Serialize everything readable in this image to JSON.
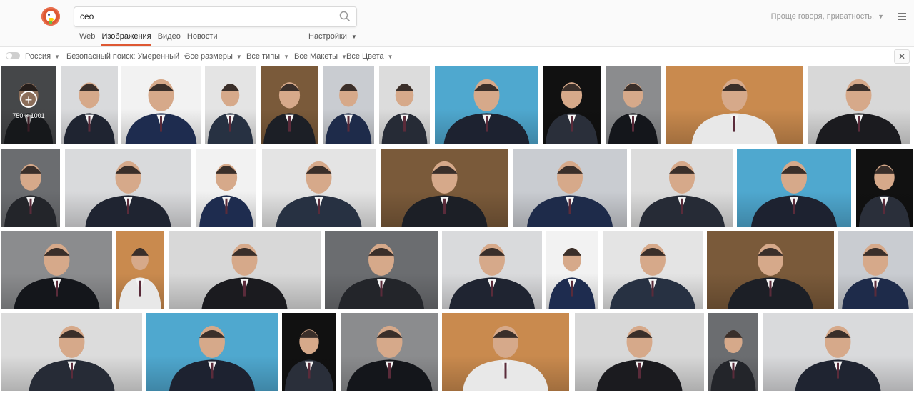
{
  "search": {
    "query": "ceo"
  },
  "header": {
    "region_menu": "Проще говоря, приватность."
  },
  "nav": {
    "tabs": [
      {
        "label": "Web"
      },
      {
        "label": "Изображения"
      },
      {
        "label": "Видео"
      },
      {
        "label": "Новости"
      }
    ],
    "settings_label": "Настройки"
  },
  "filters": {
    "region": "Россия",
    "safe_search": "Безопасный поиск: Умеренный",
    "size": "Все размеры",
    "type": "Все типы",
    "layout": "Все Макеты",
    "color": "Все Цвета"
  },
  "hovered_result": {
    "dimensions": "750 × 1001"
  },
  "colors": {
    "accent": "#de5833",
    "header_bg": "#fafafa"
  }
}
